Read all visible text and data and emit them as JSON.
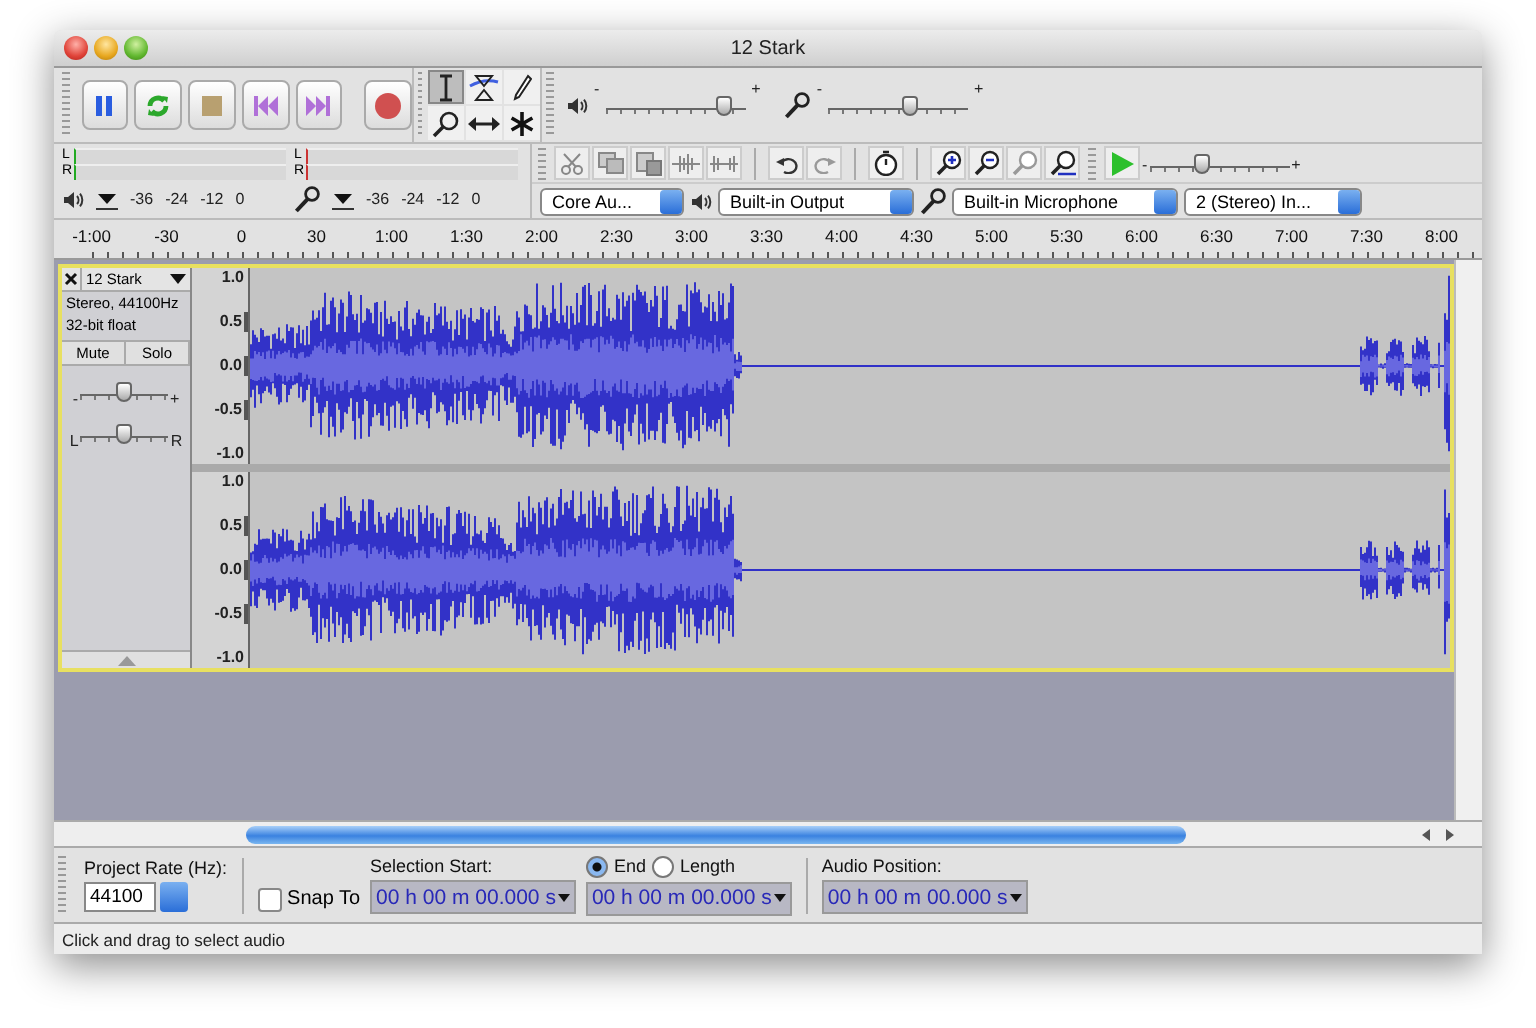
{
  "window": {
    "title": "12 Stark"
  },
  "tools": [
    {
      "kind": "select",
      "selected": true
    },
    {
      "kind": "envelope",
      "selected": false
    },
    {
      "kind": "draw",
      "selected": false
    },
    {
      "kind": "zoom",
      "selected": false
    },
    {
      "kind": "timeshift",
      "selected": false
    },
    {
      "kind": "multi",
      "selected": false
    }
  ],
  "mixer": {
    "output_volume": {
      "minus": "-",
      "plus": "+",
      "level": 0.85
    },
    "input_volume": {
      "minus": "-",
      "plus": "+",
      "level": 0.58
    }
  },
  "meters": [
    {
      "kind": "playback",
      "channels": [
        "L",
        "R"
      ],
      "scale": [
        "-36",
        "-24",
        "-12",
        "0"
      ]
    },
    {
      "kind": "recording",
      "channels": [
        "L",
        "R"
      ],
      "scale": [
        "-36",
        "-24",
        "-12",
        "0"
      ]
    }
  ],
  "play_at_speed": {
    "minus": "-",
    "plus": "+",
    "level": 0.38
  },
  "devices": {
    "host": "Core Au...",
    "output": "Built-in Output",
    "input": "Built-in Microphone",
    "input_channels": "2 (Stereo) In..."
  },
  "ruler": [
    "-1:00",
    "-30",
    "0",
    "30",
    "1:00",
    "1:30",
    "2:00",
    "2:30",
    "3:00",
    "3:30",
    "4:00",
    "4:30",
    "5:00",
    "5:30",
    "6:00",
    "6:30",
    "7:00",
    "7:30",
    "8:00"
  ],
  "track": {
    "name": "12 Stark",
    "info": [
      "Stereo, 44100Hz",
      "32-bit float"
    ],
    "mute": "Mute",
    "solo": "Solo",
    "gain": {
      "minus": "-",
      "plus": "+",
      "level": 0.5
    },
    "pan": {
      "left": "L",
      "right": "R",
      "level": 0.5
    },
    "channels": [
      {
        "scale": [
          "1.0",
          "0.5",
          "0.0",
          "-0.5",
          "-1.0"
        ]
      },
      {
        "scale": [
          "1.0",
          "0.5",
          "0.0",
          "-0.5",
          "-1.0"
        ]
      }
    ]
  },
  "selection_toolbar": {
    "project_rate": {
      "label": "Project Rate (Hz):",
      "value": "44100"
    },
    "snap_to": {
      "label": "Snap To",
      "checked": false
    },
    "selection_start": {
      "label": "Selection Start:",
      "value": "00 h 00 m 00.000 s"
    },
    "end_or_length": [
      {
        "label": "End",
        "selected": true
      },
      {
        "label": "Length",
        "selected": false
      }
    ],
    "end_value": "00 h 00 m 00.000 s",
    "audio_position": {
      "label": "Audio Position:",
      "value": "00 h 00 m 00.000 s"
    }
  },
  "status_bar": "Click and drag to select audio"
}
